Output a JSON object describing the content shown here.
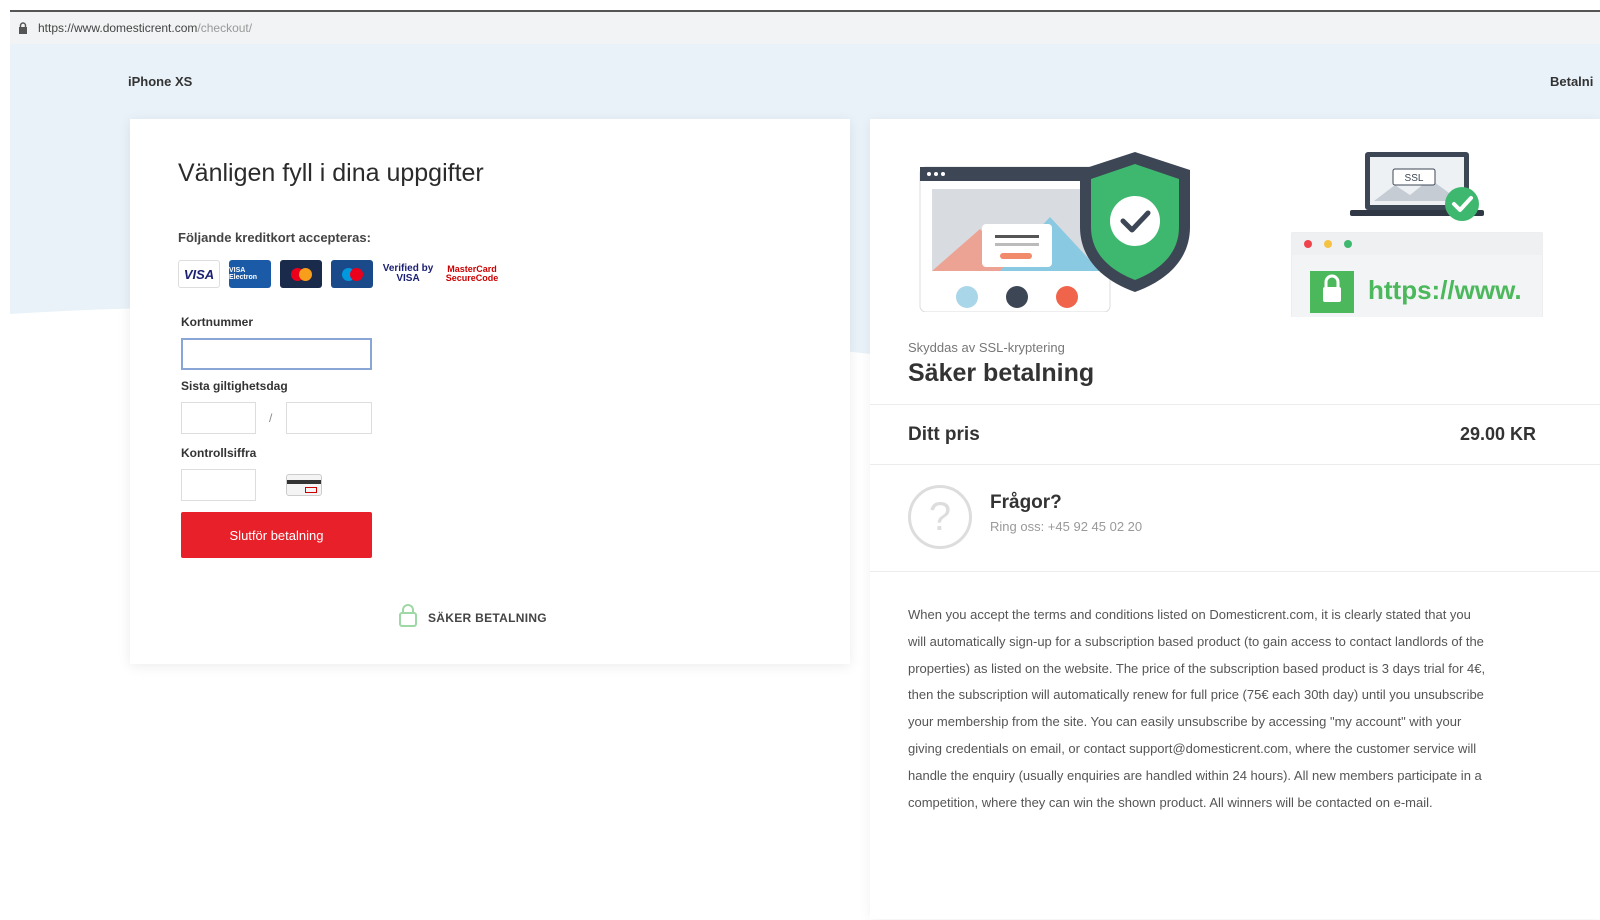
{
  "browser": {
    "url_base": "https://www.domesticrent.com",
    "url_path": "/checkout/"
  },
  "header": {
    "product": "iPhone XS",
    "step": "Betalni"
  },
  "form": {
    "title": "Vänligen fyll i dina uppgifter",
    "accepted_cards_label": "Följande kreditkort accepteras:",
    "cards": [
      "VISA",
      "VISA Electron",
      "MasterCard",
      "Maestro",
      "Verified by VISA",
      "MasterCard SecureCode"
    ],
    "card_number_label": "Kortnummer",
    "card_number_value": "",
    "expiry_label": "Sista giltighetsdag",
    "expiry_separator": "/",
    "cvc_label": "Kontrollsiffra",
    "submit_label": "Slutför betalning",
    "secure_label": "SÄKER BETALNING"
  },
  "summary": {
    "illustration_url_text": "https://www.",
    "ssl_badge": "SSL",
    "ssl_sub": "Skyddas av SSL-kryptering",
    "secure_title": "Säker betalning",
    "price_label": "Ditt pris",
    "price_value": "29.00 KR",
    "questions_title": "Frågor?",
    "questions_sub": "Ring oss: +45 92 45 02 20",
    "terms": "When you accept the terms and conditions listed on Domesticrent.com, it is clearly stated that you will automatically sign-up for a subscription based product (to gain access to contact landlords of the properties) as listed on the website. The price of the subscription based product is 3 days trial for 4€, then the subscription will automatically renew for full price (75€ each 30th day) until you unsubscribe your membership from the site. You can easily unsubscribe by accessing \"my account\" with your giving credentials on email, or contact support@domesticrent.com, where the customer service will handle the enquiry (usually enquiries are handled within 24 hours). All new members participate in a competition, where they can win the shown product. All winners will be contacted on e-mail."
  },
  "colors": {
    "background_wave": "#e8f2f8",
    "submit": "#e8202a",
    "shield": "#3fb86f",
    "lock_green": "#4cb85c"
  }
}
